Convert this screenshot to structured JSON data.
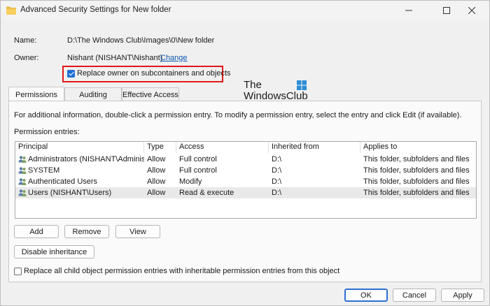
{
  "window": {
    "title": "Advanced Security Settings for New folder"
  },
  "info": {
    "name_label": "Name:",
    "name_value": "D:\\The Windows Club\\Images\\0\\New folder",
    "owner_label": "Owner:",
    "owner_value": "Nishant (NISHANT\\Nishant)",
    "change_link": "Change",
    "replace_owner_label": "Replace owner on subcontainers and objects",
    "replace_owner_checked": true
  },
  "watermark": {
    "line1": "The",
    "line2": "WindowsClub"
  },
  "tabs": [
    {
      "label": "Permissions",
      "active": true
    },
    {
      "label": "Auditing",
      "active": false
    },
    {
      "label": "Effective Access",
      "active": false
    }
  ],
  "permissions": {
    "info_text": "For additional information, double-click a permission entry. To modify a permission entry, select the entry and click Edit (if available).",
    "entries_label": "Permission entries:",
    "columns": [
      "Principal",
      "Type",
      "Access",
      "Inherited from",
      "Applies to"
    ],
    "rows": [
      {
        "principal": "Administrators (NISHANT\\Adminis...",
        "type": "Allow",
        "access": "Full control",
        "inherited": "D:\\",
        "applies": "This folder, subfolders and files"
      },
      {
        "principal": "SYSTEM",
        "type": "Allow",
        "access": "Full control",
        "inherited": "D:\\",
        "applies": "This folder, subfolders and files"
      },
      {
        "principal": "Authenticated Users",
        "type": "Allow",
        "access": "Modify",
        "inherited": "D:\\",
        "applies": "This folder, subfolders and files"
      },
      {
        "principal": "Users (NISHANT\\Users)",
        "type": "Allow",
        "access": "Read & execute",
        "inherited": "D:\\",
        "applies": "This folder, subfolders and files"
      }
    ],
    "selected_row": 3,
    "add_button": "Add",
    "remove_button": "Remove",
    "view_button": "View",
    "disable_inheritance_button": "Disable inheritance",
    "replace_all_label": "Replace all child object permission entries with inheritable permission entries from this object",
    "replace_all_checked": false
  },
  "footer": {
    "ok_button": "OK",
    "cancel_button": "Cancel",
    "apply_button": "Apply"
  },
  "colors": {
    "highlight_border": "#e01818",
    "link": "#0a57b0",
    "checkbox_accent": "#1f6fd1"
  }
}
